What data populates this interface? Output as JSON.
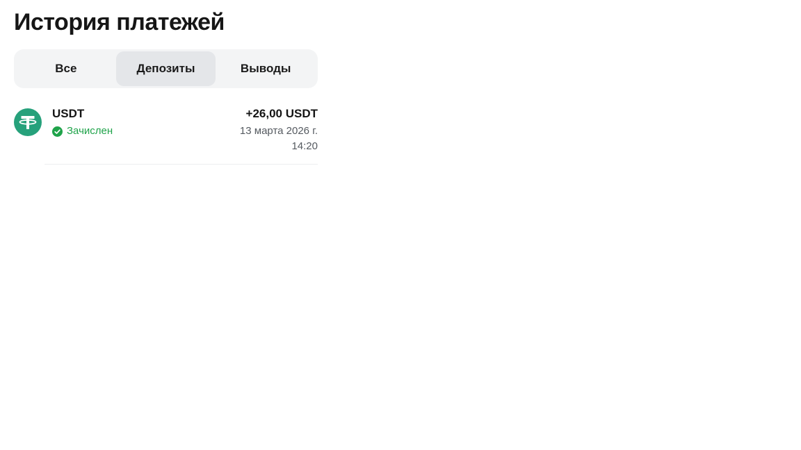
{
  "page": {
    "title": "История платежей"
  },
  "tabs": [
    {
      "label": "Все",
      "active": false
    },
    {
      "label": "Депозиты",
      "active": true
    },
    {
      "label": "Выводы",
      "active": false
    }
  ],
  "transactions": [
    {
      "currency": "USDT",
      "icon": "tether-icon",
      "status": "Зачислен",
      "status_icon": "check-circle-icon",
      "amount": "+26,00 USDT",
      "date": "13 марта 2026 г.",
      "time": "14:20"
    }
  ],
  "colors": {
    "tether_green": "#26a17b",
    "status_green": "#1fa34a",
    "tab_bar_bg": "#f3f4f5",
    "tab_active_bg": "#e4e6e9"
  }
}
